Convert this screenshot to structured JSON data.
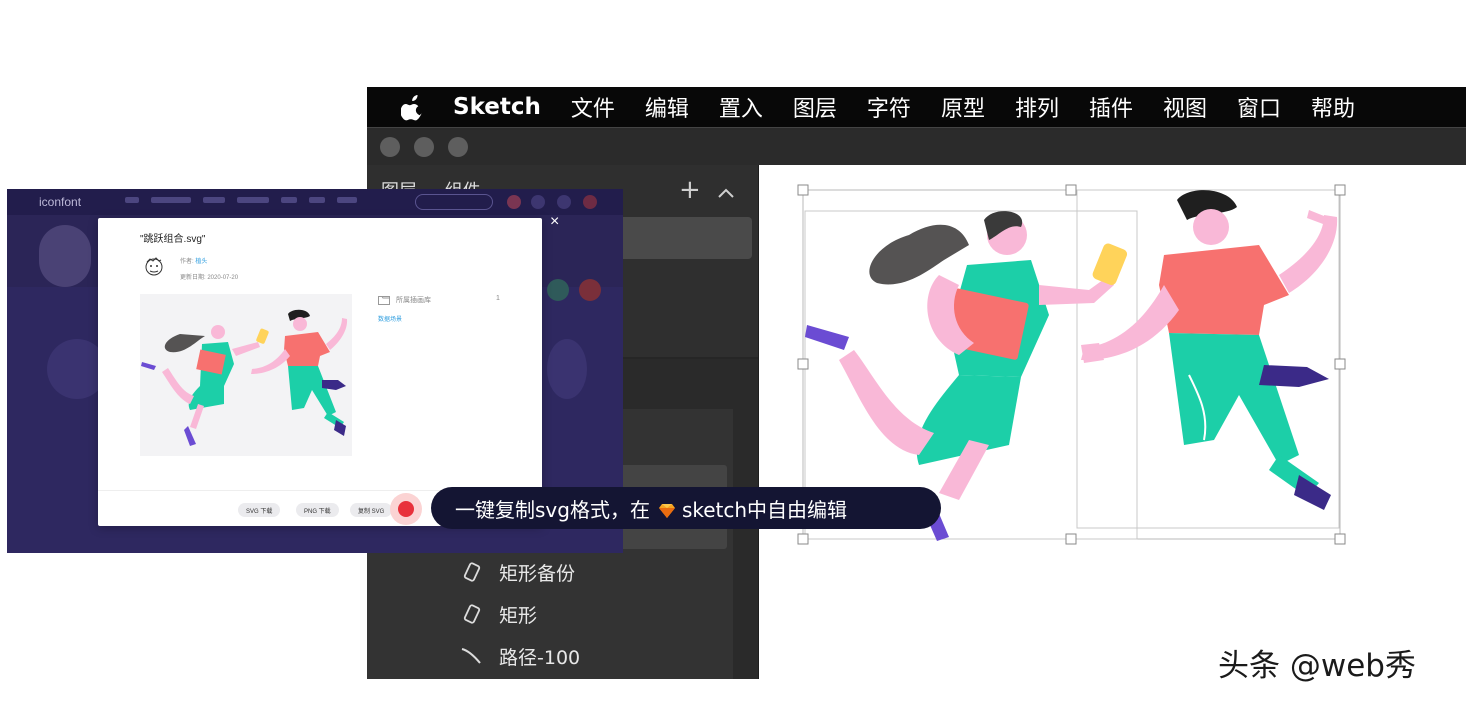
{
  "menubar": {
    "apple_icon": "apple-icon",
    "app_name": "Sketch",
    "items": [
      "文件",
      "编辑",
      "置入",
      "图层",
      "字符",
      "原型",
      "排列",
      "插件",
      "视图",
      "窗口",
      "帮助"
    ]
  },
  "sidebar": {
    "tabs": [
      "图层",
      "组件"
    ],
    "add_icon": "plus-icon",
    "collapse_icon": "chevron-up-icon",
    "layers": [
      {
        "label": "矩形备份",
        "icon": "rectangle-icon"
      },
      {
        "label": "矩形",
        "icon": "rectangle-icon"
      },
      {
        "label": "路径-100",
        "icon": "path-icon"
      }
    ]
  },
  "browser": {
    "logo": "iconfont"
  },
  "modal": {
    "title": "\"跳跃组合.svg\"",
    "author_label": "作者:",
    "author_value": "植头",
    "date_label": "更新日期:",
    "date_value": "2020-07-20",
    "library_label": "所属插画库",
    "library_count": "1",
    "link_text": "数据场景",
    "buttons": [
      "SVG 下载",
      "PNG 下载",
      "复制 SVG"
    ],
    "close": "×"
  },
  "callout": {
    "text_before": "一键复制svg格式，在",
    "gem_icon": "sketch-diamond-icon",
    "text_after": "sketch中自由编辑"
  },
  "watermark": "头条 @web秀",
  "colors": {
    "menubar_bg": "#080808",
    "sidebar_bg": "#2f2f2f",
    "browser_bg": "#2b2557",
    "accent_red": "#e8313b",
    "callout_bg": "#141533",
    "teal": "#1ccfa8",
    "salmon": "#f7716f",
    "purple": "#5a3fc0"
  }
}
